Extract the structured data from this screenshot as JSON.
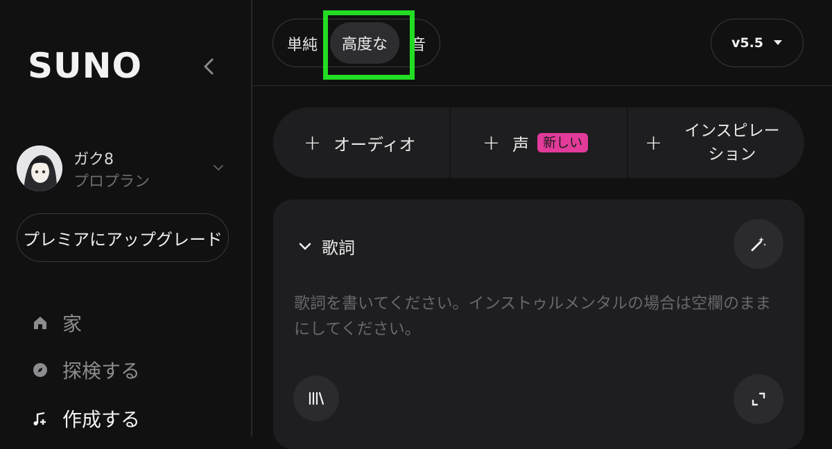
{
  "sidebar": {
    "logo": "SUNO",
    "user": {
      "name": "ガク8",
      "plan": "プロプラン"
    },
    "upgrade_label": "プレミアにアップグレード",
    "nav": [
      {
        "label": "家",
        "icon": "home-icon"
      },
      {
        "label": "探検する",
        "icon": "compass-icon"
      },
      {
        "label": "作成する",
        "icon": "music-plus-icon"
      }
    ]
  },
  "header": {
    "modes": {
      "simple": "単純",
      "advanced": "高度な",
      "audio": "音"
    },
    "version": "v5.5"
  },
  "add_row": {
    "audio_label": "オーディオ",
    "voice_label": "声",
    "voice_badge": "新しい",
    "inspiration_line1": "インスピレー",
    "inspiration_line2": "ション"
  },
  "lyrics": {
    "title": "歌詞",
    "placeholder": "歌詞を書いてください。インストゥルメンタルの場合は空欄のままにしてください。"
  },
  "colors": {
    "highlight": "#22dd22",
    "badge": "#e23b9a",
    "top_bar": "#e5432a"
  }
}
